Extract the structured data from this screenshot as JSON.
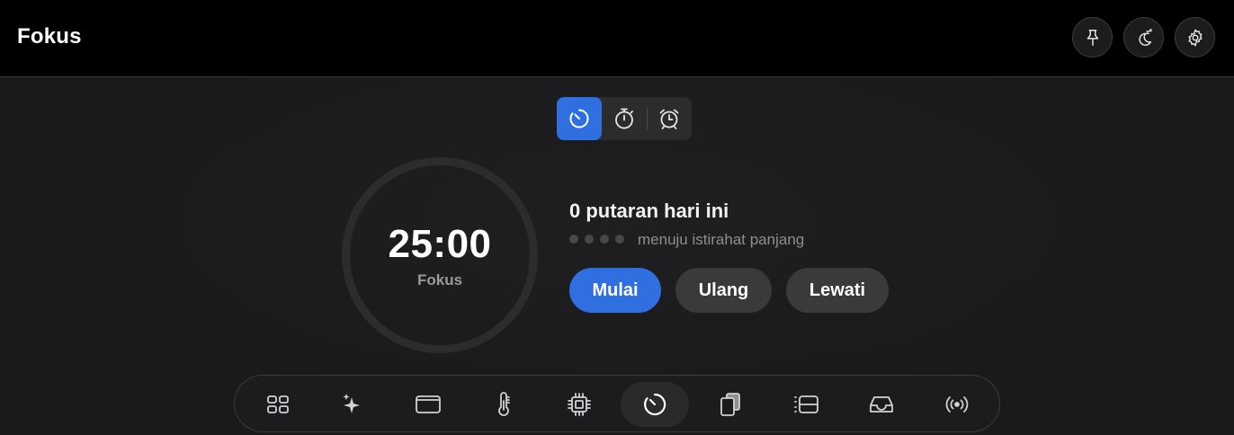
{
  "header": {
    "title": "Fokus",
    "buttons": [
      {
        "name": "pin-button",
        "icon": "pin-icon"
      },
      {
        "name": "sleep-button",
        "icon": "moon-zzz-icon"
      },
      {
        "name": "settings-button",
        "icon": "gear-icon"
      }
    ]
  },
  "modes": {
    "items": [
      {
        "icon": "timer-icon",
        "active": true
      },
      {
        "icon": "stopwatch-icon",
        "active": false
      },
      {
        "icon": "alarm-clock-icon",
        "active": false
      }
    ]
  },
  "timer": {
    "time": "25:00",
    "phase": "Fokus",
    "rounds_text": "0 putaran hari ini",
    "dots_total": 4,
    "dots_filled": 0,
    "dots_label": "menuju istirahat panjang"
  },
  "controls": {
    "start_label": "Mulai",
    "reset_label": "Ulang",
    "skip_label": "Lewati"
  },
  "dock": {
    "items": [
      {
        "icon": "grid-icon",
        "active": false
      },
      {
        "icon": "sparkles-icon",
        "active": false
      },
      {
        "icon": "window-icon",
        "active": false
      },
      {
        "icon": "thermometer-icon",
        "active": false
      },
      {
        "icon": "cpu-chip-icon",
        "active": false
      },
      {
        "icon": "timer-icon",
        "active": true
      },
      {
        "icon": "clipboard-copy-icon",
        "active": false
      },
      {
        "icon": "list-icon",
        "active": false
      },
      {
        "icon": "inbox-tray-icon",
        "active": false
      },
      {
        "icon": "broadcast-icon",
        "active": false
      }
    ]
  },
  "colors": {
    "accent": "#2f6fe0",
    "background": "#1c1c1e",
    "titlebar": "#000000"
  }
}
